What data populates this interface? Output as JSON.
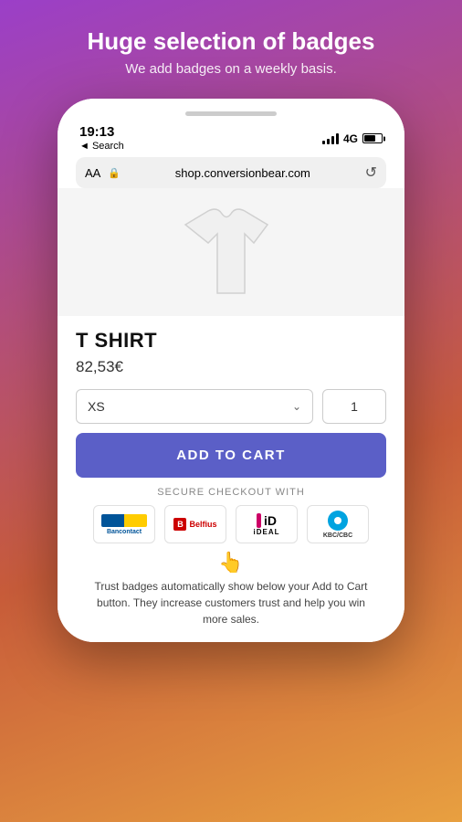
{
  "header": {
    "title": "Huge selection of badges",
    "subtitle": "We add badges on a weekly basis."
  },
  "phone": {
    "status_bar": {
      "time": "19:13",
      "search_label": "◄ Search",
      "network": "4G"
    },
    "url_bar": {
      "aa_label": "AA",
      "lock_icon": "🔒",
      "url": "shop.conversionbear.com",
      "reload_icon": "↺"
    },
    "product": {
      "title": "T SHIRT",
      "price": "82,53€",
      "size_default": "XS",
      "quantity": "1",
      "add_to_cart_label": "ADD TO CART",
      "secure_checkout_label": "SECURE CHECKOUT WITH"
    },
    "payment_methods": [
      {
        "name": "Bancontact",
        "id": "bancontact"
      },
      {
        "name": "Belfius",
        "id": "belfius"
      },
      {
        "name": "iDEAL",
        "id": "ideal"
      },
      {
        "name": "KBC/CBC",
        "id": "kbc"
      }
    ],
    "trust": {
      "emoji": "👆",
      "text": "Trust badges automatically show below your Add to Cart button. They increase customers trust and help you win more sales."
    }
  }
}
